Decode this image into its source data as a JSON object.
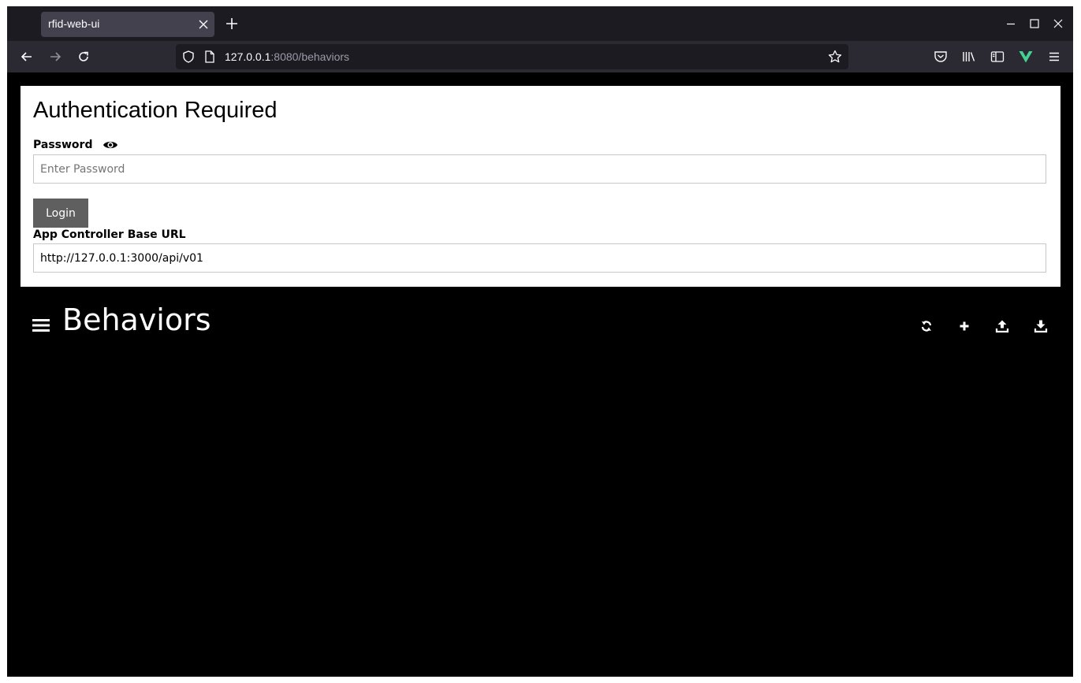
{
  "browser": {
    "tab_title": "rfid-web-ui",
    "url_host": "127.0.0.1",
    "url_path": ":8080/behaviors"
  },
  "auth": {
    "title": "Authentication Required",
    "password_label": "Password",
    "password_placeholder": "Enter Password",
    "password_value": "",
    "login_label": "Login",
    "base_url_label": "App Controller Base URL",
    "base_url_value": "http://127.0.0.1:3000/api/v01"
  },
  "behaviors": {
    "title": "Behaviors",
    "actions": [
      "refresh-icon",
      "add-icon",
      "upload-icon",
      "download-icon"
    ]
  },
  "colors": {
    "chrome_tabbar": "#1c1b22",
    "chrome_navbar": "#2b2a33",
    "login_button": "#5f5f5f",
    "page_background": "#000000",
    "vue_accent": "#42d392"
  }
}
